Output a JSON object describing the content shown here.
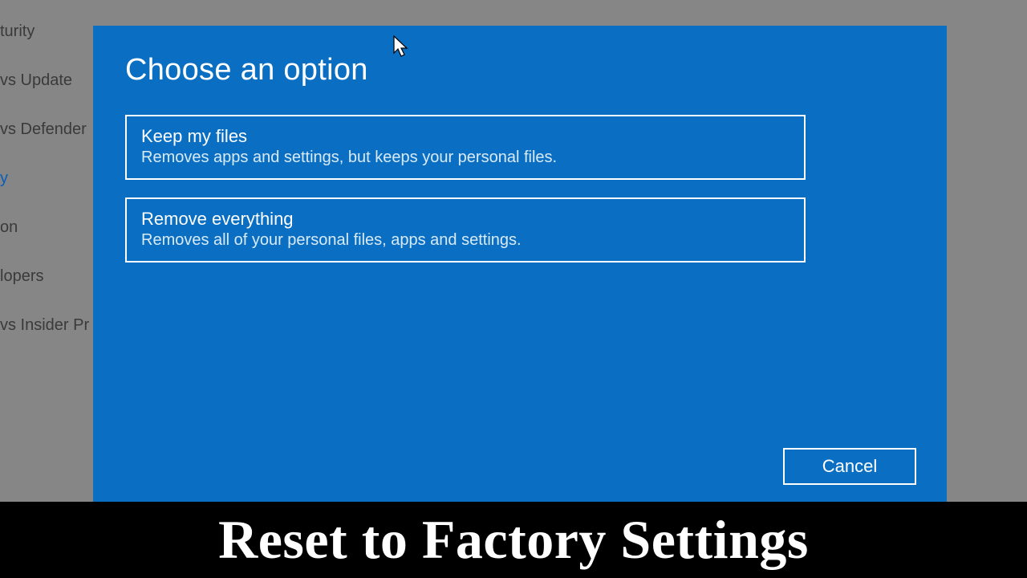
{
  "sidebar": {
    "items": [
      {
        "label": "turity"
      },
      {
        "label": "vs Update"
      },
      {
        "label": "vs Defender"
      },
      {
        "label": "y"
      },
      {
        "label": "on"
      },
      {
        "label": "lopers"
      },
      {
        "label": "vs Insider Pr"
      }
    ],
    "active_index": 3
  },
  "dialog": {
    "title": "Choose an option",
    "options": [
      {
        "title": "Keep my files",
        "desc": "Removes apps and settings, but keeps your personal files."
      },
      {
        "title": "Remove everything",
        "desc": "Removes all of your personal files, apps and settings."
      }
    ],
    "cancel_label": "Cancel"
  },
  "caption": "Reset to Factory Settings"
}
